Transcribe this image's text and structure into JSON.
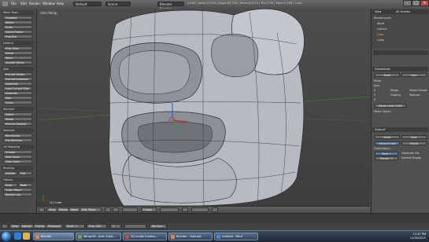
{
  "topbar": {
    "menus": [
      "File",
      "Add",
      "Render",
      "Window",
      "Help"
    ],
    "layout": "Default",
    "scene": "Scene",
    "engine": "Blender Render",
    "stats": "v2.60 | Verts:5/1376 | Edges:8/2744 | Faces:4/1370 | Tris:2740 | Mem:9.43M | Cube"
  },
  "toolshelf": {
    "sections": [
      {
        "label": "Mesh Tools",
        "buttons": [
          "Translate",
          "Rotate",
          "Scale",
          "Shrink/Flatten",
          "Push/Pull"
        ]
      },
      {
        "label": "Deform",
        "buttons": [
          "Slide Edge",
          "Vertex",
          "Noise",
          "Smooth Vertex"
        ]
      },
      {
        "label": "Add",
        "buttons": [
          "Extrude Region",
          "Extrude Individual",
          "Subdivide",
          "Loop Cut and Slide",
          "Duplicate",
          "Spin",
          "Screw"
        ]
      },
      {
        "label": "Remove",
        "buttons": [
          "Delete",
          "Merge",
          "Remove Doubles"
        ]
      },
      {
        "label": "Normals",
        "buttons": [
          "Recalculate",
          "Flip Direction"
        ]
      },
      {
        "label": "UV Mapping",
        "buttons": [
          "Unwrap",
          "Mark Seam",
          "Clear Seam"
        ]
      },
      {
        "label": "Shading",
        "buttons": [
          "Smooth",
          "Flat"
        ]
      },
      {
        "label": "History",
        "buttons": [
          "Undo",
          "Redo",
          "Undo History",
          "Repeat Last"
        ]
      }
    ]
  },
  "viewport": {
    "title": "User Persp",
    "object_label": "(1) Cube"
  },
  "viewport_header": {
    "view": "View",
    "select": "Select",
    "mesh": "Mesh",
    "mode": "Edit Mode",
    "pivot": "Global"
  },
  "timeline": {
    "view": "View",
    "marker": "Marker",
    "frame": "Frame",
    "playback": "Playback",
    "start": "Start: 1",
    "end": "End: 250",
    "current": "1",
    "keying": "No Sync"
  },
  "outliner": {
    "view": "View",
    "search": "All Scenes",
    "items": [
      "RenderLayers",
      "World",
      "Camera",
      "Cube",
      "Lamp"
    ]
  },
  "properties": {
    "panel": "Subdivision",
    "apply": "Apply",
    "copy": "Copy",
    "type_simple": "Simple",
    "type_catmull": "Catmull-Clark",
    "subdivisions_label": "Subdivisions:",
    "view_value": "View: 2",
    "render_value": "Render: 2",
    "options_label": "Options:",
    "optimal_display": "Optimal Display",
    "mirror_panel": "Mirror",
    "axis_label": "Axis:",
    "x": "X",
    "y": "Y",
    "z": "Z",
    "merge": "Merge",
    "clipping": "Clipping",
    "vertex_groups": "Vertex Groups",
    "textures": "Textures",
    "merge_limit": "Merge Limit: 0.001",
    "mirror_object": "Mirror Object:",
    "subsurf2": "Subsurf",
    "apply2": "Apply",
    "copy2": "Copy",
    "simple2": "Simple",
    "catmull2": "Catmull-Clark",
    "subdivs2": "Subdivisions:",
    "view2": "View: 1",
    "render2": "Render: 2",
    "subdivide_uvs": "Subdivide UVs",
    "optimal2": "Optimal Display"
  },
  "taskbar": {
    "tasks": [
      "Blender",
      "Wings3D - Add: Subd...",
      "3D model Creator...",
      "Blender - Tutorials",
      "Untitled - Paint"
    ],
    "time": "11:47 PM",
    "date": "11/16/2011"
  },
  "colors": {
    "accent": "#5378a8",
    "viewport_bg": "#454545",
    "mesh_face": "#b9bcc4",
    "mesh_wire": "#2b2b2b"
  }
}
